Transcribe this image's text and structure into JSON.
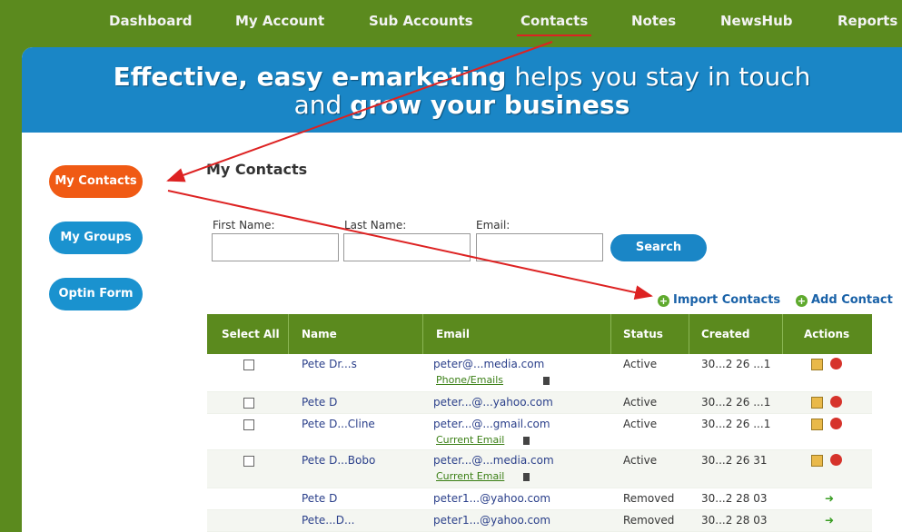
{
  "nav": {
    "items": [
      {
        "label": "Dashboard",
        "active": false
      },
      {
        "label": "My Account",
        "active": false
      },
      {
        "label": "Sub Accounts",
        "active": false
      },
      {
        "label": "Contacts",
        "active": true
      },
      {
        "label": "Notes",
        "active": false
      },
      {
        "label": "NewsHub",
        "active": false
      },
      {
        "label": "Reports",
        "active": false
      }
    ]
  },
  "banner": {
    "line1_bold": "Effective, easy e-marketing",
    "line1_rest": "helps you stay in touch",
    "line2_plain": "and",
    "line2_bold": "grow your business"
  },
  "sidebar": {
    "items": [
      {
        "label": "My Contacts",
        "active": true
      },
      {
        "label": "My Groups",
        "active": false
      },
      {
        "label": "Optin Form",
        "active": false
      }
    ]
  },
  "main": {
    "title": "My Contacts",
    "search": {
      "first_name_label": "First Name:",
      "last_name_label": "Last Name:",
      "email_label": "Email:",
      "first_name_value": "",
      "last_name_value": "",
      "email_value": "",
      "button_label": "Search"
    },
    "import_label": "Import Contacts",
    "add_label": "Add Contact"
  },
  "table": {
    "headers": [
      "Select All",
      "Name",
      "Email",
      "Status",
      "Created",
      "Actions"
    ],
    "rows": [
      {
        "name": "Pete Dr...s",
        "email": "peter@...media.com",
        "status": "Active",
        "created": "30...2 26 ...1",
        "sub_link": "Phone/Emails",
        "has_checkbox": true,
        "action": "edit-delete"
      },
      {
        "name": "Pete D",
        "email": "peter...@...yahoo.com",
        "status": "Active",
        "created": "30...2 26 ...1",
        "sub_link": "",
        "has_checkbox": true,
        "action": "edit-delete"
      },
      {
        "name": "Pete D...Cline",
        "email": "peter...@...gmail.com",
        "status": "Active",
        "created": "30...2 26 ...1",
        "sub_link": "Current Email",
        "has_checkbox": true,
        "action": "edit-delete"
      },
      {
        "name": "Pete D...Bobo",
        "email": "peter...@...media.com",
        "status": "Active",
        "created": "30...2 26 31",
        "sub_link": "Current Email",
        "has_checkbox": true,
        "action": "edit-delete"
      },
      {
        "name": "Pete D",
        "email": "peter1...@yahoo.com",
        "status": "Removed",
        "created": "30...2 28 03",
        "sub_link": "",
        "has_checkbox": false,
        "action": "restore"
      },
      {
        "name": "Pete...D...",
        "email": "peter1...@yahoo.com",
        "status": "Removed",
        "created": "30...2 28 03",
        "sub_link": "",
        "has_checkbox": false,
        "action": "restore"
      }
    ]
  },
  "colors": {
    "brand_green": "#5b8a1e",
    "banner_blue": "#1a86c6",
    "active_orange": "#f05a14",
    "annotation_red": "#dd2222"
  }
}
